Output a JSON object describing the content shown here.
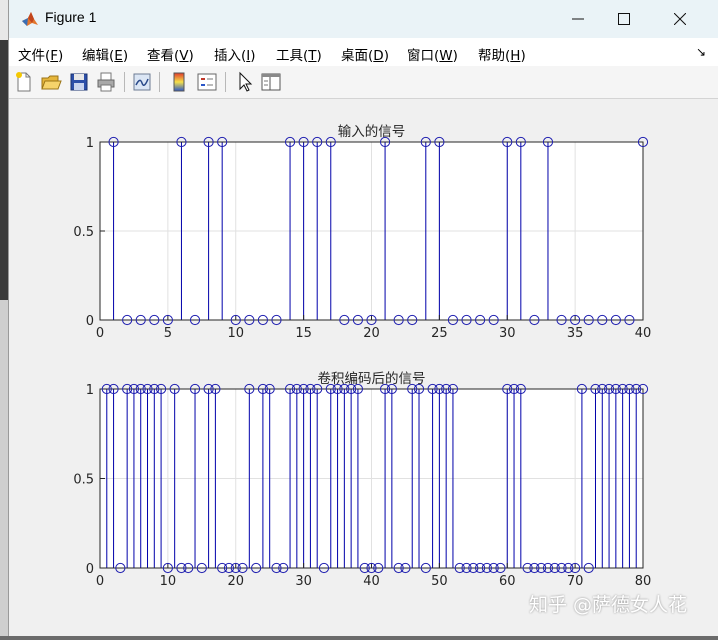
{
  "window": {
    "title": "Figure 1"
  },
  "menu": [
    {
      "label": "文件(",
      "key": "F",
      "end": ")"
    },
    {
      "label": "编辑(",
      "key": "E",
      "end": ")"
    },
    {
      "label": "查看(",
      "key": "V",
      "end": ")"
    },
    {
      "label": "插入(",
      "key": "I",
      "end": ")"
    },
    {
      "label": "工具(",
      "key": "T",
      "end": ")"
    },
    {
      "label": "桌面(",
      "key": "D",
      "end": ")"
    },
    {
      "label": "窗口(",
      "key": "W",
      "end": ")"
    },
    {
      "label": "帮助(",
      "key": "H",
      "end": ")"
    }
  ],
  "toolbar_icons": [
    "new-figure-icon",
    "open-file-icon",
    "save-icon",
    "print-icon",
    "link-plot-icon",
    "colorbar-icon",
    "legend-icon",
    "pointer-icon",
    "property-inspector-icon"
  ],
  "colors": {
    "stem": "#0000aa",
    "marker": "#1f1fb0",
    "axes_bg": "#ffffff",
    "figure_bg": "#f0f0f0"
  },
  "chart_data": [
    {
      "type": "stem",
      "title": "输入的信号",
      "xlim": [
        0,
        40
      ],
      "ylim": [
        0,
        1
      ],
      "xticks": [
        0,
        5,
        10,
        15,
        20,
        25,
        30,
        35,
        40
      ],
      "yticks": [
        0,
        0.5,
        1
      ],
      "ytick_labels": [
        "0",
        "0.5",
        "1"
      ],
      "grid": true,
      "x": [
        1,
        2,
        3,
        4,
        5,
        6,
        7,
        8,
        9,
        10,
        11,
        12,
        13,
        14,
        15,
        16,
        17,
        18,
        19,
        20,
        21,
        22,
        23,
        24,
        25,
        26,
        27,
        28,
        29,
        30,
        31,
        32,
        33,
        34,
        35,
        36,
        37,
        38,
        39,
        40
      ],
      "y": [
        1,
        0,
        0,
        0,
        0,
        1,
        0,
        1,
        1,
        0,
        0,
        0,
        0,
        1,
        1,
        1,
        1,
        0,
        0,
        0,
        1,
        0,
        0,
        1,
        1,
        0,
        0,
        0,
        0,
        1,
        1,
        0,
        1,
        0,
        0,
        0,
        0,
        0,
        0,
        1
      ]
    },
    {
      "type": "stem",
      "title": "卷积编码后的信号",
      "xlim": [
        0,
        80
      ],
      "ylim": [
        0,
        1
      ],
      "xticks": [
        0,
        10,
        20,
        30,
        40,
        50,
        60,
        70,
        80
      ],
      "yticks": [
        0,
        0.5,
        1
      ],
      "ytick_labels": [
        "0",
        "0.5",
        "1"
      ],
      "grid": true,
      "x": [
        1,
        2,
        3,
        4,
        5,
        6,
        7,
        8,
        9,
        10,
        11,
        12,
        13,
        14,
        15,
        16,
        17,
        18,
        19,
        20,
        21,
        22,
        23,
        24,
        25,
        26,
        27,
        28,
        29,
        30,
        31,
        32,
        33,
        34,
        35,
        36,
        37,
        38,
        39,
        40,
        41,
        42,
        43,
        44,
        45,
        46,
        47,
        48,
        49,
        50,
        51,
        52,
        53,
        54,
        55,
        56,
        57,
        58,
        59,
        60,
        61,
        62,
        63,
        64,
        65,
        66,
        67,
        68,
        69,
        70,
        71,
        72,
        73,
        74,
        75,
        76,
        77,
        78,
        79,
        80
      ],
      "y": [
        1,
        1,
        0,
        1,
        1,
        1,
        1,
        1,
        1,
        0,
        1,
        0,
        0,
        1,
        0,
        1,
        1,
        0,
        0,
        0,
        0,
        1,
        0,
        1,
        1,
        0,
        0,
        1,
        1,
        1,
        1,
        1,
        0,
        1,
        1,
        1,
        1,
        1,
        0,
        0,
        0,
        1,
        1,
        0,
        0,
        1,
        1,
        0,
        1,
        1,
        1,
        1,
        0,
        0,
        0,
        0,
        0,
        0,
        0,
        1,
        1,
        1,
        0,
        0,
        0,
        0,
        0,
        0,
        0,
        0,
        1,
        0,
        1,
        1,
        1,
        1,
        1,
        1,
        1,
        1
      ]
    }
  ],
  "watermark": "知乎 @萨德女人花"
}
